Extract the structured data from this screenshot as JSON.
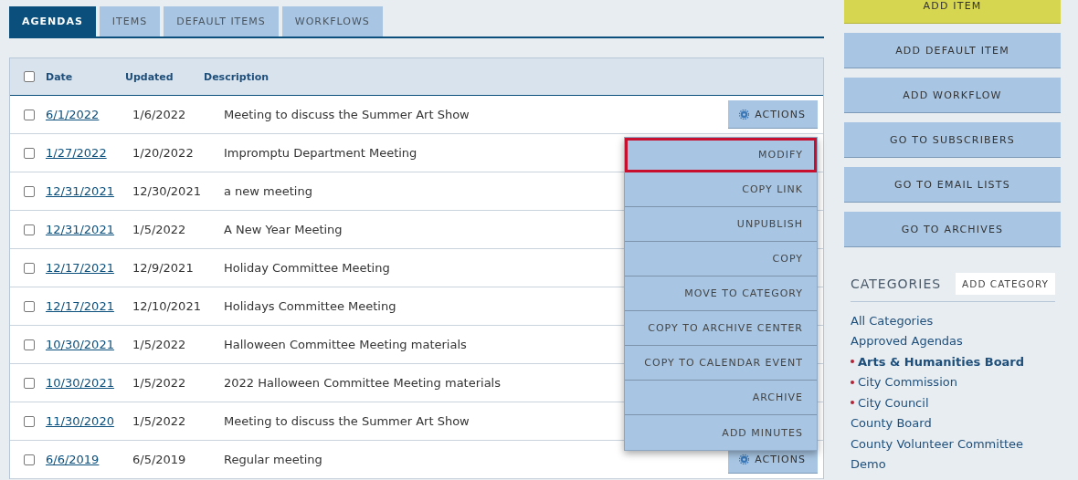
{
  "tabs": [
    {
      "label": "AGENDAS",
      "selected": true
    },
    {
      "label": "ITEMS",
      "selected": false
    },
    {
      "label": "DEFAULT ITEMS",
      "selected": false
    },
    {
      "label": "WORKFLOWS",
      "selected": false
    }
  ],
  "table": {
    "select_all": {
      "checked": false
    },
    "columns": [
      "Date",
      "Updated",
      "Description"
    ],
    "rows": [
      {
        "checked": false,
        "date": "6/1/2022",
        "updated": "1/6/2022",
        "description": "Meeting to discuss the Summer Art Show",
        "actions": "ACTIONS"
      },
      {
        "checked": false,
        "date": "1/27/2022",
        "updated": "1/20/2022",
        "description": "Impromptu Department Meeting"
      },
      {
        "checked": false,
        "date": "12/31/2021",
        "updated": "12/30/2021",
        "description": "a new meeting"
      },
      {
        "checked": false,
        "date": "12/31/2021",
        "updated": "1/5/2022",
        "description": "A New Year Meeting"
      },
      {
        "checked": false,
        "date": "12/17/2021",
        "updated": "12/9/2021",
        "description": "Holiday Committee Meeting"
      },
      {
        "checked": false,
        "date": "12/17/2021",
        "updated": "12/10/2021",
        "description": "Holidays Committee Meeting"
      },
      {
        "checked": false,
        "date": "10/30/2021",
        "updated": "1/5/2022",
        "description": "Halloween Committee Meeting materials"
      },
      {
        "checked": false,
        "date": "10/30/2021",
        "updated": "1/5/2022",
        "description": "2022 Halloween Committee Meeting materials"
      },
      {
        "checked": false,
        "date": "11/30/2020",
        "updated": "1/5/2022",
        "description": "Meeting to discuss the Summer Art Show"
      },
      {
        "checked": false,
        "date": "6/6/2019",
        "updated": "6/5/2019",
        "description": "Regular meeting",
        "actions": "ACTIONS"
      }
    ]
  },
  "actions_menu": [
    {
      "label": "MODIFY",
      "selected": true
    },
    {
      "label": "COPY LINK",
      "selected": false
    },
    {
      "label": "UNPUBLISH",
      "selected": false
    },
    {
      "label": "COPY",
      "selected": false
    },
    {
      "label": "MOVE TO CATEGORY",
      "selected": false
    },
    {
      "label": "COPY TO ARCHIVE CENTER",
      "selected": false
    },
    {
      "label": "COPY TO CALENDAR EVENT",
      "selected": false
    },
    {
      "label": "ARCHIVE",
      "selected": false
    },
    {
      "label": "ADD MINUTES",
      "selected": false
    }
  ],
  "sidebar": {
    "buttons": [
      {
        "label": "ADD ITEM",
        "kind": "primary"
      },
      {
        "label": "ADD DEFAULT ITEM",
        "kind": "secondary"
      },
      {
        "label": "ADD WORKFLOW",
        "kind": "secondary"
      },
      {
        "label": "GO TO SUBSCRIBERS",
        "kind": "secondary"
      },
      {
        "label": "GO TO EMAIL LISTS",
        "kind": "secondary"
      },
      {
        "label": "GO TO ARCHIVES",
        "kind": "secondary"
      }
    ],
    "categories": {
      "title": "CATEGORIES",
      "add_button": "ADD CATEGORY",
      "items": [
        {
          "label": "All Categories",
          "dot": false,
          "selected": false
        },
        {
          "label": "Approved Agendas",
          "dot": false,
          "selected": false
        },
        {
          "label": "Arts & Humanities Board",
          "dot": true,
          "selected": true
        },
        {
          "label": "City Commission",
          "dot": true,
          "selected": false
        },
        {
          "label": "City Council",
          "dot": true,
          "selected": false
        },
        {
          "label": "County Board",
          "dot": false,
          "selected": false
        },
        {
          "label": "County Volunteer Committee",
          "dot": false,
          "selected": false
        },
        {
          "label": "Demo",
          "dot": false,
          "selected": false
        }
      ]
    }
  }
}
